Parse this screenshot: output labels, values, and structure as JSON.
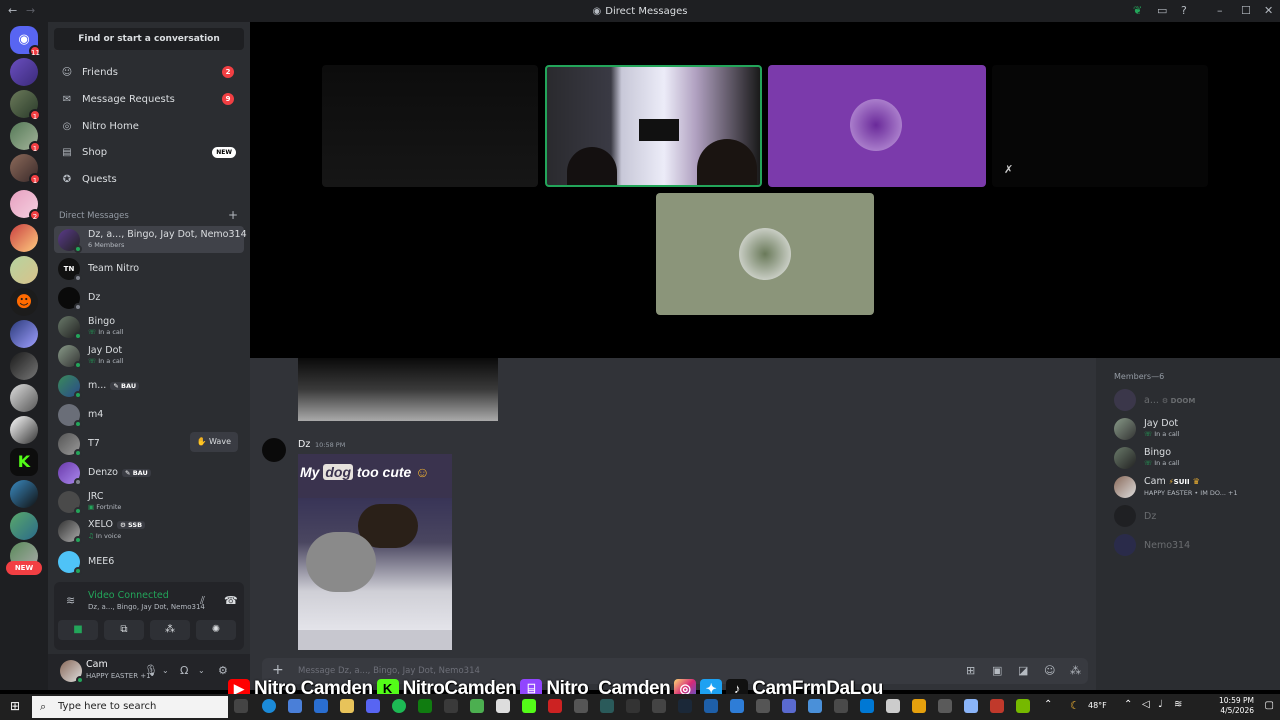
{
  "window": {
    "title": "Direct Messages"
  },
  "rail": {
    "badges": [
      "11",
      "1",
      "1",
      "1",
      "1",
      "2"
    ],
    "new_label": "NEW"
  },
  "sidebar": {
    "find": "Find or start a conversation",
    "nav": [
      {
        "label": "Friends",
        "icon": "friends-icon",
        "count": "2"
      },
      {
        "label": "Message Requests",
        "icon": "mail-icon",
        "count": "9"
      },
      {
        "label": "Nitro Home",
        "icon": "nitro-icon"
      },
      {
        "label": "Shop",
        "icon": "shop-icon",
        "badge": "NEW"
      },
      {
        "label": "Quests",
        "icon": "quests-icon"
      }
    ],
    "dm_header": "Direct Messages",
    "dms": [
      {
        "name": "Dz, a..., Bingo, Jay Dot, Nemo314",
        "sub": "6 Members"
      },
      {
        "name": "Team Nitro"
      },
      {
        "name": "Dz"
      },
      {
        "name": "Bingo",
        "sub": "In a call"
      },
      {
        "name": "Jay Dot",
        "sub": "In a call"
      },
      {
        "name": "m...",
        "tag": "BAU"
      },
      {
        "name": "m4"
      },
      {
        "name": "T7",
        "wave": "Wave"
      },
      {
        "name": "Denzo",
        "tag": "BAU"
      },
      {
        "name": "JRC",
        "sub": "Fortnite"
      },
      {
        "name": "XELO",
        "tag": "SSB",
        "sub": "In voice"
      },
      {
        "name": "MEE6"
      }
    ]
  },
  "voice": {
    "status": "Video Connected",
    "channel": "Dz, a..., Bingo, Jay Dot, Nemo314"
  },
  "user": {
    "name": "Cam",
    "status": "HAPPY EASTER",
    "extra": "+1"
  },
  "chat": {
    "author": "Dz",
    "time": "10:58 PM",
    "caption_a": "My ",
    "caption_b": "dog",
    "caption_c": " too cute",
    "placeholder": "Message Dz, a..., Bingo, Jay Dot, Nemo314"
  },
  "members": {
    "header": "Members—6",
    "list": [
      {
        "name": "a...",
        "tag": "DOOM"
      },
      {
        "name": "Jay Dot",
        "sub": "In a call"
      },
      {
        "name": "Bingo",
        "sub": "In a call"
      },
      {
        "name": "Cam",
        "tag": "SUII",
        "sub": "HAPPY EASTER • IM DO...",
        "extra": "+1"
      },
      {
        "name": "Dz"
      },
      {
        "name": "Nemo314"
      }
    ]
  },
  "social": {
    "youtube": "Nitro Camden",
    "kick": "NitroCamden",
    "twitch": "Nitro_Camden",
    "socials": "CamFrmDaLou"
  },
  "taskbar": {
    "search": "Type here to search",
    "temp": "48°F",
    "time": "10:59 PM",
    "date": "4/5/2026"
  },
  "colors": {
    "accent": "#5865f2",
    "green": "#23a55a",
    "red": "#f23f43"
  }
}
